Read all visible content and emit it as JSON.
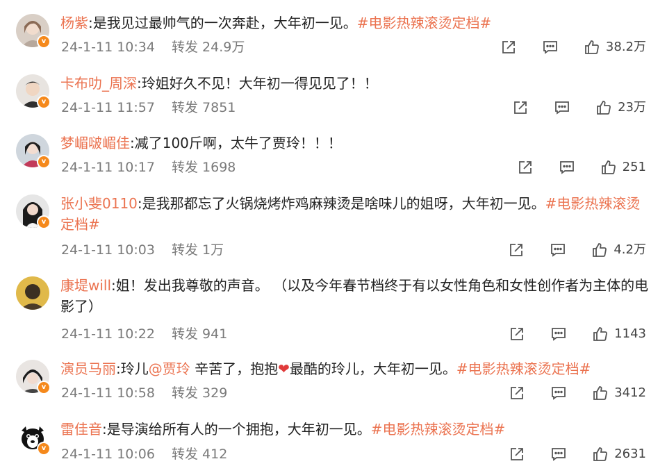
{
  "comments": [
    {
      "user": "杨紫",
      "text": ":是我见过最帅气的一次奔赴，大年初一见。",
      "tag": "#电影热辣滚烫定档#",
      "text2": "",
      "time": "24-1-11 10:34",
      "repost_label": "转发",
      "reposts": "24.9万",
      "likes": "38.2万"
    },
    {
      "user": "卡布叻_周深",
      "text": ":玲姐好久不见！大年初一得见见了！！",
      "tag": "",
      "text2": "",
      "time": "24-1-11 11:57",
      "repost_label": "转发",
      "reposts": "7851",
      "likes": "23万"
    },
    {
      "user": "梦嵋啵嵋佳",
      "text": ":减了100斤啊，太牛了贾玲！！！",
      "tag": "",
      "text2": "",
      "time": "24-1-11 10:17",
      "repost_label": "转发",
      "reposts": "1698",
      "likes": "251"
    },
    {
      "user": "张小斐0110",
      "text": ":是我那都忘了火锅烧烤炸鸡麻辣烫是啥味儿的姐呀，大年初一见。",
      "tag": "#电影热辣滚烫定档#",
      "text2": "",
      "time": "24-1-11 10:03",
      "repost_label": "转发",
      "reposts": "1万",
      "likes": "4.2万"
    },
    {
      "user": "康堤will",
      "text": ":姐！发出我尊敬的声音。 （以及今年春节档终于有以女性角色和女性创作者为主体的电影了）",
      "tag": "",
      "text2": "",
      "time": "24-1-11 10:22",
      "repost_label": "转发",
      "reposts": "941",
      "likes": "1143"
    },
    {
      "user": "演员马丽",
      "text": ":玲儿",
      "mention": "@贾玲",
      "text_mid": " 辛苦了，抱抱",
      "text2": "最酷的玲儿，大年初一见。",
      "tag": "#电影热辣滚烫定档#",
      "time": "24-1-11 10:58",
      "repost_label": "转发",
      "reposts": "329",
      "likes": "3412"
    },
    {
      "user": "雷佳音",
      "text": ":是导演给所有人的一个拥抱，大年初一见。",
      "tag": "#电影热辣滚烫定档#",
      "text2": "",
      "time": "24-1-11 10:06",
      "repost_label": "转发",
      "reposts": "412",
      "likes": "2631"
    }
  ],
  "colors": {
    "username": "#eb7350",
    "hashtag": "#eb7350",
    "meta": "#7a7a7a",
    "badge": "#f5891c"
  },
  "icons": {
    "share": "share-icon",
    "comment": "comment-icon",
    "like": "like-icon",
    "verified": "verified-badge-icon"
  }
}
